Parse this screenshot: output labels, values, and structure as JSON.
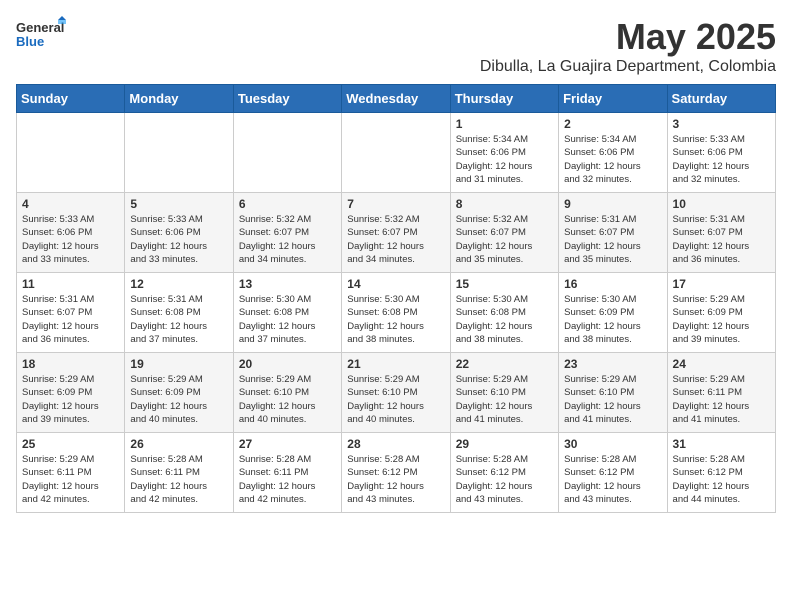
{
  "logo": {
    "general": "General",
    "blue": "Blue"
  },
  "title": {
    "month": "May 2025",
    "location": "Dibulla, La Guajira Department, Colombia"
  },
  "weekdays": [
    "Sunday",
    "Monday",
    "Tuesday",
    "Wednesday",
    "Thursday",
    "Friday",
    "Saturday"
  ],
  "weeks": [
    [
      {
        "day": "",
        "info": ""
      },
      {
        "day": "",
        "info": ""
      },
      {
        "day": "",
        "info": ""
      },
      {
        "day": "",
        "info": ""
      },
      {
        "day": "1",
        "info": "Sunrise: 5:34 AM\nSunset: 6:06 PM\nDaylight: 12 hours\nand 31 minutes."
      },
      {
        "day": "2",
        "info": "Sunrise: 5:34 AM\nSunset: 6:06 PM\nDaylight: 12 hours\nand 32 minutes."
      },
      {
        "day": "3",
        "info": "Sunrise: 5:33 AM\nSunset: 6:06 PM\nDaylight: 12 hours\nand 32 minutes."
      }
    ],
    [
      {
        "day": "4",
        "info": "Sunrise: 5:33 AM\nSunset: 6:06 PM\nDaylight: 12 hours\nand 33 minutes."
      },
      {
        "day": "5",
        "info": "Sunrise: 5:33 AM\nSunset: 6:06 PM\nDaylight: 12 hours\nand 33 minutes."
      },
      {
        "day": "6",
        "info": "Sunrise: 5:32 AM\nSunset: 6:07 PM\nDaylight: 12 hours\nand 34 minutes."
      },
      {
        "day": "7",
        "info": "Sunrise: 5:32 AM\nSunset: 6:07 PM\nDaylight: 12 hours\nand 34 minutes."
      },
      {
        "day": "8",
        "info": "Sunrise: 5:32 AM\nSunset: 6:07 PM\nDaylight: 12 hours\nand 35 minutes."
      },
      {
        "day": "9",
        "info": "Sunrise: 5:31 AM\nSunset: 6:07 PM\nDaylight: 12 hours\nand 35 minutes."
      },
      {
        "day": "10",
        "info": "Sunrise: 5:31 AM\nSunset: 6:07 PM\nDaylight: 12 hours\nand 36 minutes."
      }
    ],
    [
      {
        "day": "11",
        "info": "Sunrise: 5:31 AM\nSunset: 6:07 PM\nDaylight: 12 hours\nand 36 minutes."
      },
      {
        "day": "12",
        "info": "Sunrise: 5:31 AM\nSunset: 6:08 PM\nDaylight: 12 hours\nand 37 minutes."
      },
      {
        "day": "13",
        "info": "Sunrise: 5:30 AM\nSunset: 6:08 PM\nDaylight: 12 hours\nand 37 minutes."
      },
      {
        "day": "14",
        "info": "Sunrise: 5:30 AM\nSunset: 6:08 PM\nDaylight: 12 hours\nand 38 minutes."
      },
      {
        "day": "15",
        "info": "Sunrise: 5:30 AM\nSunset: 6:08 PM\nDaylight: 12 hours\nand 38 minutes."
      },
      {
        "day": "16",
        "info": "Sunrise: 5:30 AM\nSunset: 6:09 PM\nDaylight: 12 hours\nand 38 minutes."
      },
      {
        "day": "17",
        "info": "Sunrise: 5:29 AM\nSunset: 6:09 PM\nDaylight: 12 hours\nand 39 minutes."
      }
    ],
    [
      {
        "day": "18",
        "info": "Sunrise: 5:29 AM\nSunset: 6:09 PM\nDaylight: 12 hours\nand 39 minutes."
      },
      {
        "day": "19",
        "info": "Sunrise: 5:29 AM\nSunset: 6:09 PM\nDaylight: 12 hours\nand 40 minutes."
      },
      {
        "day": "20",
        "info": "Sunrise: 5:29 AM\nSunset: 6:10 PM\nDaylight: 12 hours\nand 40 minutes."
      },
      {
        "day": "21",
        "info": "Sunrise: 5:29 AM\nSunset: 6:10 PM\nDaylight: 12 hours\nand 40 minutes."
      },
      {
        "day": "22",
        "info": "Sunrise: 5:29 AM\nSunset: 6:10 PM\nDaylight: 12 hours\nand 41 minutes."
      },
      {
        "day": "23",
        "info": "Sunrise: 5:29 AM\nSunset: 6:10 PM\nDaylight: 12 hours\nand 41 minutes."
      },
      {
        "day": "24",
        "info": "Sunrise: 5:29 AM\nSunset: 6:11 PM\nDaylight: 12 hours\nand 41 minutes."
      }
    ],
    [
      {
        "day": "25",
        "info": "Sunrise: 5:29 AM\nSunset: 6:11 PM\nDaylight: 12 hours\nand 42 minutes."
      },
      {
        "day": "26",
        "info": "Sunrise: 5:28 AM\nSunset: 6:11 PM\nDaylight: 12 hours\nand 42 minutes."
      },
      {
        "day": "27",
        "info": "Sunrise: 5:28 AM\nSunset: 6:11 PM\nDaylight: 12 hours\nand 42 minutes."
      },
      {
        "day": "28",
        "info": "Sunrise: 5:28 AM\nSunset: 6:12 PM\nDaylight: 12 hours\nand 43 minutes."
      },
      {
        "day": "29",
        "info": "Sunrise: 5:28 AM\nSunset: 6:12 PM\nDaylight: 12 hours\nand 43 minutes."
      },
      {
        "day": "30",
        "info": "Sunrise: 5:28 AM\nSunset: 6:12 PM\nDaylight: 12 hours\nand 43 minutes."
      },
      {
        "day": "31",
        "info": "Sunrise: 5:28 AM\nSunset: 6:12 PM\nDaylight: 12 hours\nand 44 minutes."
      }
    ]
  ]
}
